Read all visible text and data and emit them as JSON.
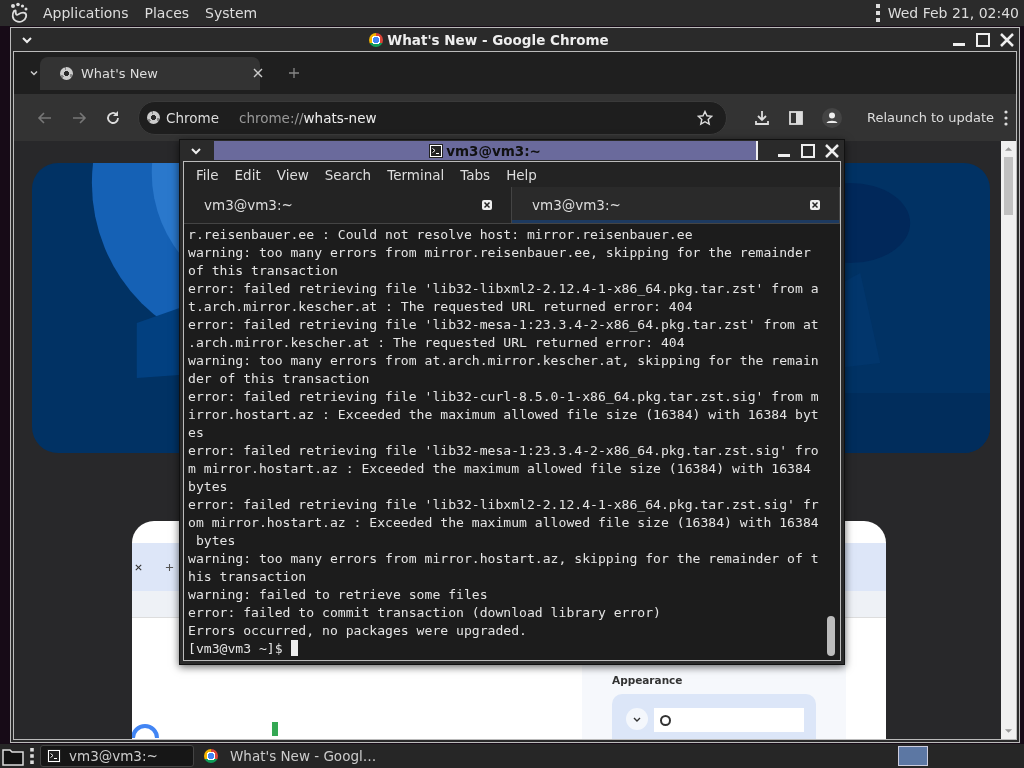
{
  "top_panel": {
    "menus": [
      "Applications",
      "Places",
      "System"
    ],
    "clock": "Wed Feb 21, 02:40"
  },
  "chrome": {
    "title": "What's New - Google Chrome",
    "tabs": [
      {
        "label": "What's New",
        "selected": true
      }
    ],
    "omnibox": {
      "chip": "Chrome",
      "url_scheme": "chrome://",
      "url_path": "whats-new"
    },
    "relaunch": "Relaunch to update",
    "page": {
      "section_label": "Appearance"
    }
  },
  "terminal": {
    "title": "vm3@vm3:~",
    "menus": [
      "File",
      "Edit",
      "View",
      "Search",
      "Terminal",
      "Tabs",
      "Help"
    ],
    "tabs": [
      {
        "label": "vm3@vm3:~",
        "selected": false
      },
      {
        "label": "vm3@vm3:~",
        "selected": true
      }
    ],
    "lines": [
      "r.reisenbauer.ee : Could not resolve host: mirror.reisenbauer.ee",
      "warning: too many errors from mirror.reisenbauer.ee, skipping for the remainder",
      "of this transaction",
      "error: failed retrieving file 'lib32-libxml2-2.12.4-1-x86_64.pkg.tar.zst' from a",
      "t.arch.mirror.kescher.at : The requested URL returned error: 404",
      "error: failed retrieving file 'lib32-mesa-1:23.3.4-2-x86_64.pkg.tar.zst' from at",
      ".arch.mirror.kescher.at : The requested URL returned error: 404",
      "warning: too many errors from at.arch.mirror.kescher.at, skipping for the remain",
      "der of this transaction",
      "error: failed retrieving file 'lib32-curl-8.5.0-1-x86_64.pkg.tar.zst.sig' from m",
      "irror.hostart.az : Exceeded the maximum allowed file size (16384) with 16384 byt",
      "es",
      "error: failed retrieving file 'lib32-mesa-1:23.3.4-2-x86_64.pkg.tar.zst.sig' fro",
      "m mirror.hostart.az : Exceeded the maximum allowed file size (16384) with 16384",
      "bytes",
      "error: failed retrieving file 'lib32-libxml2-2.12.4-1-x86_64.pkg.tar.zst.sig' fr",
      "om mirror.hostart.az : Exceeded the maximum allowed file size (16384) with 16384",
      " bytes",
      "warning: too many errors from mirror.hostart.az, skipping for the remainder of t",
      "his transaction",
      "warning: failed to retrieve some files",
      "error: failed to commit transaction (download library error)",
      "Errors occurred, no packages were upgraded."
    ],
    "prompt": "[vm3@vm3 ~]$"
  },
  "taskbar": {
    "tasks": [
      {
        "label": "vm3@vm3:~",
        "kind": "terminal",
        "selected": true
      },
      {
        "label": "What's New - Googl…",
        "kind": "browser",
        "selected": false
      }
    ]
  }
}
